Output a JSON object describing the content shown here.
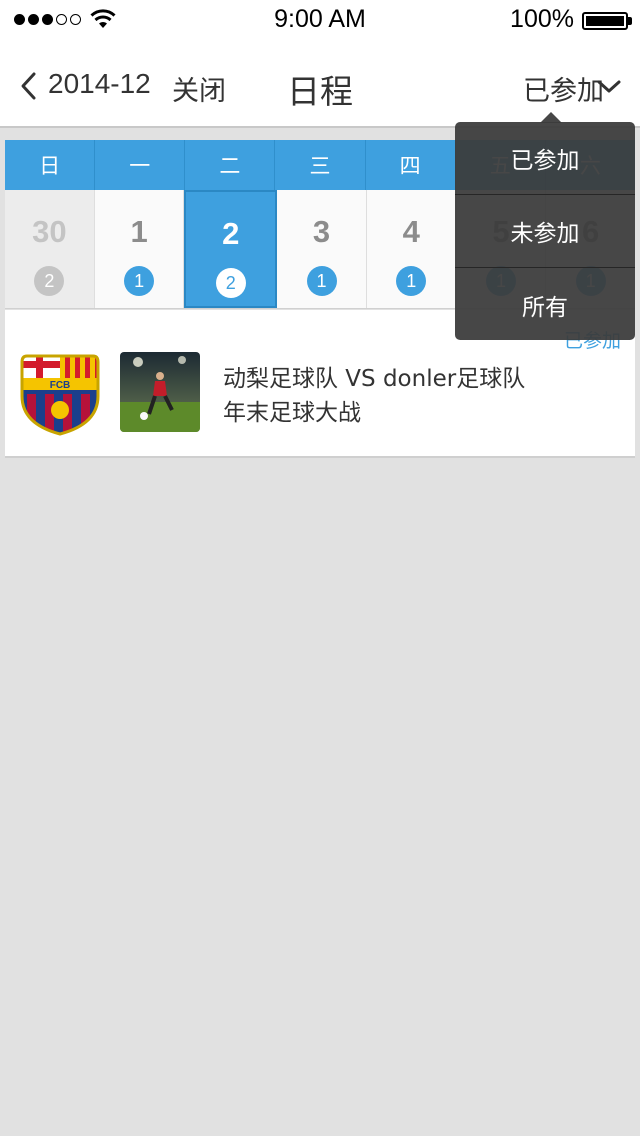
{
  "status_bar": {
    "time": "9:00 AM",
    "battery": "100%"
  },
  "nav": {
    "month": "2014-12",
    "close": "关闭",
    "title": "日程",
    "filter": "已参加"
  },
  "calendar": {
    "weekdays": [
      "日",
      "一",
      "二",
      "三",
      "四",
      "五",
      "六"
    ],
    "days": [
      {
        "num": "30",
        "count": "2"
      },
      {
        "num": "1",
        "count": "1"
      },
      {
        "num": "2",
        "count": "2"
      },
      {
        "num": "3",
        "count": "1"
      },
      {
        "num": "4",
        "count": "1"
      },
      {
        "num": "5",
        "count": "1"
      },
      {
        "num": "6",
        "count": "1"
      }
    ]
  },
  "event": {
    "status": "已参加",
    "title_line1": "动梨足球队 VS donler足球队",
    "title_line2": "年末足球大战",
    "crest_text": "FCB"
  },
  "dropdown": {
    "items": [
      "已参加",
      "未参加",
      "所有"
    ]
  }
}
